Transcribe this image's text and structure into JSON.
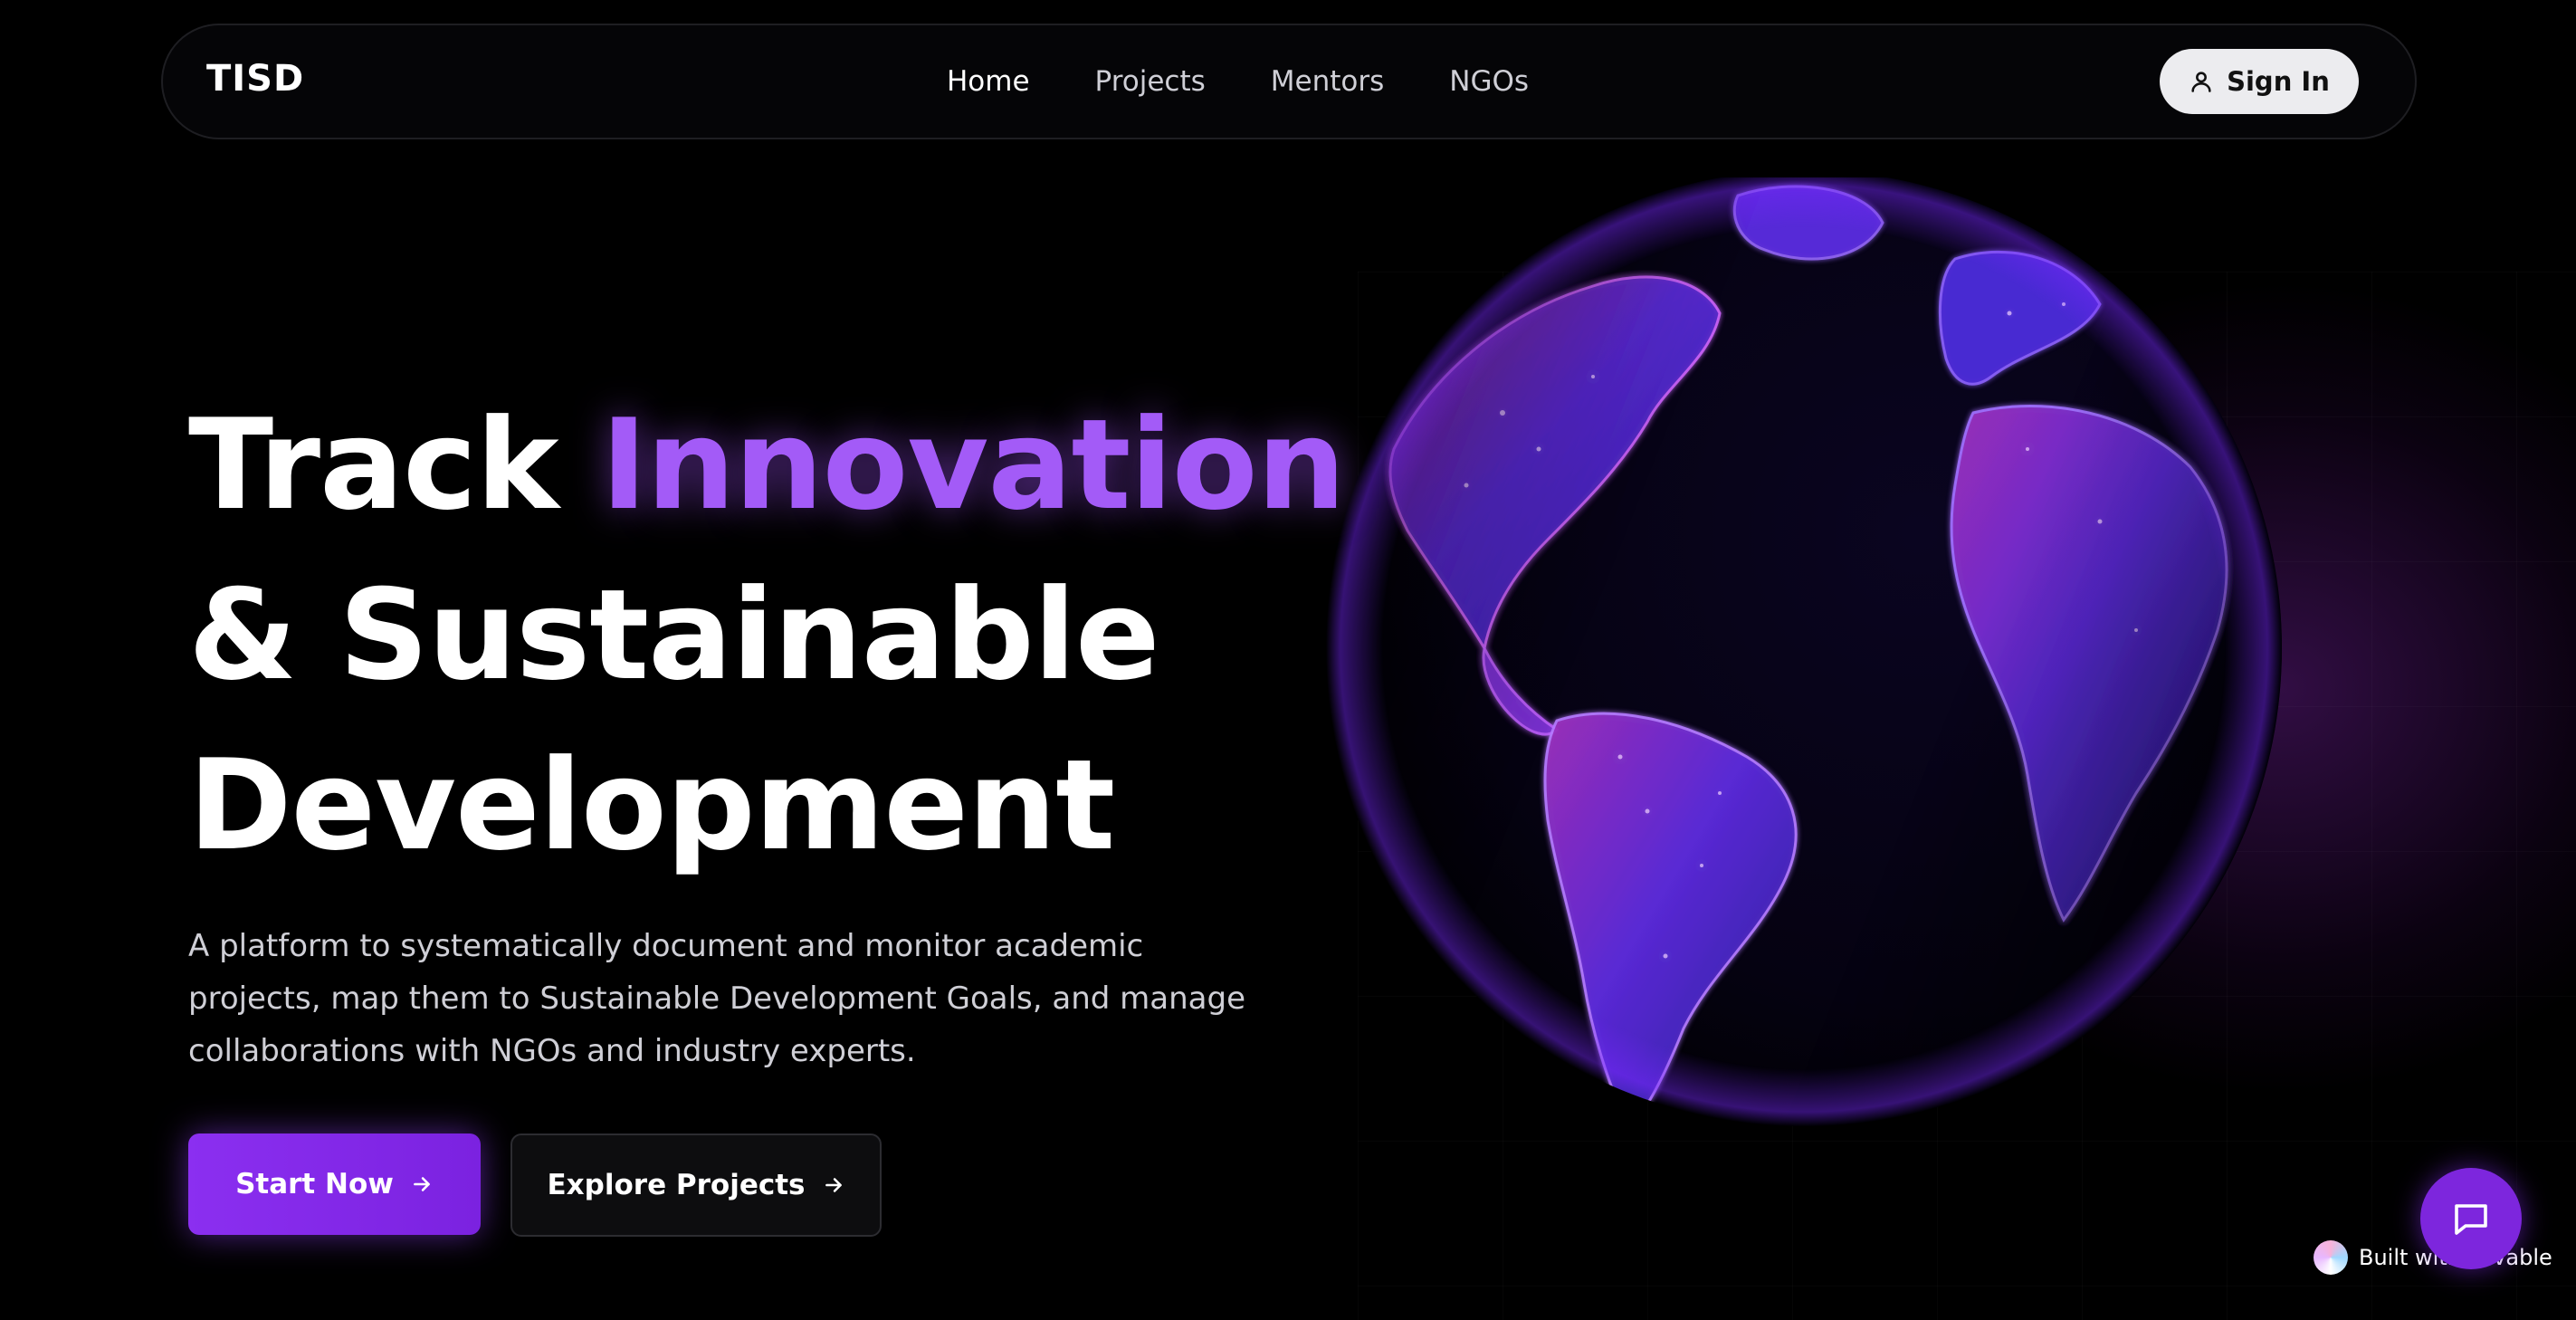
{
  "nav": {
    "brand": "TISD",
    "links": [
      {
        "label": "Home",
        "active": true
      },
      {
        "label": "Projects",
        "active": false
      },
      {
        "label": "Mentors",
        "active": false
      },
      {
        "label": "NGOs",
        "active": false
      }
    ],
    "signin_label": "Sign In"
  },
  "hero": {
    "title_part1": "Track ",
    "title_accent": "Innovation",
    "title_line2": "& Sustainable",
    "title_line3": "Development",
    "description": "A platform to systematically document and monitor academic projects, map them to Sustainable Development Goals, and manage collaborations with NGOs and industry experts.",
    "primary_cta": "Start Now",
    "secondary_cta": "Explore Projects"
  },
  "footer_badge": {
    "text": "Built with Lovable"
  },
  "icons": {
    "signin": "user-icon",
    "cta_arrow": "arrow-right-icon",
    "chat": "chat-bubble-icon",
    "globe": "earth-globe-graphic"
  },
  "colors": {
    "accent": "#a35bf7",
    "primary_button": "#8b2ff0",
    "chat_button": "#7d26dd",
    "background": "#000000"
  }
}
